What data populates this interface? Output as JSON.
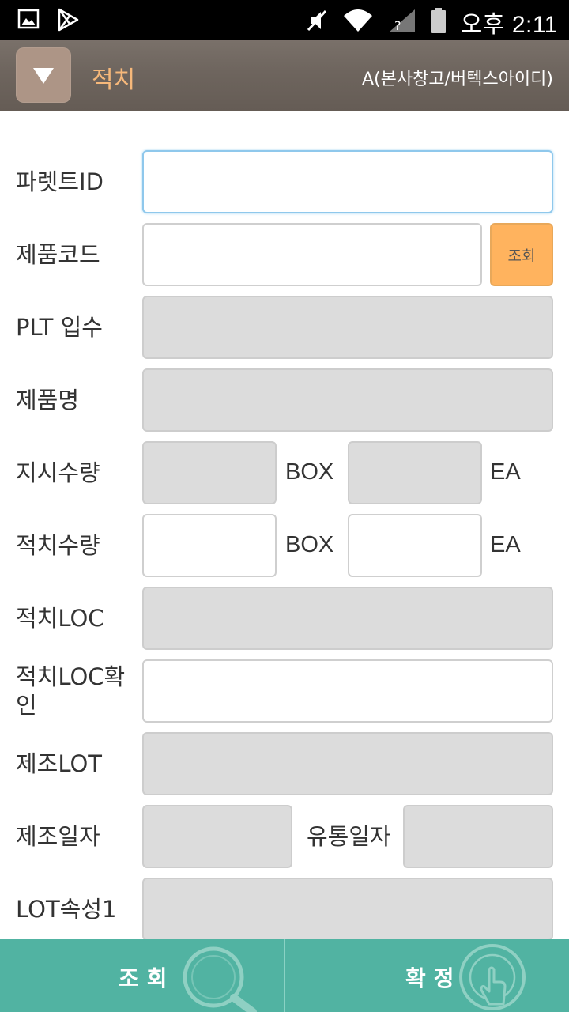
{
  "status_bar": {
    "time": "오후 2:11",
    "icons": [
      "image-icon",
      "play-store-icon",
      "mute-icon",
      "wifi-icon",
      "no-sim-icon",
      "battery-icon"
    ]
  },
  "header": {
    "menu_icon": "triangle-down-icon",
    "title": "적치",
    "warehouse": "A(본사창고/버텍스아이디)"
  },
  "form": {
    "pallet_id": {
      "label": "파렛트ID",
      "value": ""
    },
    "product_code": {
      "label": "제품코드",
      "value": "",
      "search_label": "조회"
    },
    "plt_qty": {
      "label": "PLT 입수",
      "value": ""
    },
    "product_name": {
      "label": "제품명",
      "value": ""
    },
    "order_qty": {
      "label": "지시수량",
      "box_value": "",
      "box_unit": "BOX",
      "ea_value": "",
      "ea_unit": "EA"
    },
    "putaway_qty": {
      "label": "적치수량",
      "box_value": "",
      "box_unit": "BOX",
      "ea_value": "",
      "ea_unit": "EA"
    },
    "putaway_loc": {
      "label": "적치LOC",
      "value": ""
    },
    "putaway_loc_confirm": {
      "label": "적치LOC확인",
      "value": ""
    },
    "mfg_lot": {
      "label": "제조LOT",
      "value": ""
    },
    "mfg_date": {
      "label": "제조일자",
      "value": ""
    },
    "exp_date": {
      "label": "유통일자",
      "value": ""
    },
    "lot_attr1": {
      "label": "LOT속성1",
      "value": ""
    }
  },
  "bottom_bar": {
    "search_label": "조회",
    "confirm_label": "확정",
    "search_icon": "magnifier-icon",
    "confirm_icon": "touch-icon"
  },
  "colors": {
    "status_bar": "#000000",
    "header_bg": "#6e655e",
    "title_accent": "#f6b87a",
    "menu_button": "#ad9586",
    "search_button": "#ffb35e",
    "bottom_bar": "#51b3a2",
    "disabled_field": "#dcdcdc",
    "focus_border": "#8fc8ec"
  }
}
